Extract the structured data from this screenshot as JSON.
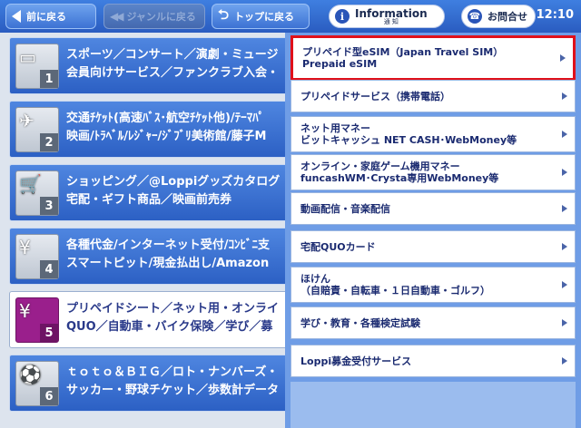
{
  "topbar": {
    "back_label": "前に戻る",
    "genre_back_label": "ジャンルに戻る",
    "top_label": "トップに戻る",
    "info_label": "Information",
    "info_sub": "通 知",
    "contact_label": "お問合せ",
    "time": "12:10"
  },
  "categories": [
    {
      "num": "1",
      "line1": "スポーツ／コンサート／演劇・ミュージ",
      "line2": "会員向けサービス／ファンクラブ入会・",
      "icon": "ticket-icon"
    },
    {
      "num": "2",
      "line1": "交通ﾁｹｯﾄ(高速ﾊﾞｽ･航空ﾁｹｯﾄ他)/ﾃｰﾏﾊﾟ",
      "line2": "映画/ﾄﾗﾍﾞﾙ/ﾚｼﾞｬｰ/ｼﾞﾌﾞﾘ美術館/藤子M",
      "icon": "airplane-icon"
    },
    {
      "num": "3",
      "line1": "ショッピング／@Loppiグッズカタログ",
      "line2": "宅配・ギフト商品／映画前売券",
      "icon": "cart-icon"
    },
    {
      "num": "4",
      "line1": "各種代金/インターネット受付/ｺﾝﾋﾞﾆ支",
      "line2": "スマートピット/現金払出し/Amazon",
      "icon": "yen-icon"
    },
    {
      "num": "5",
      "line1": "プリペイドシート／ネット用・オンライ",
      "line2": "QUO／自動車・バイク保険／学び／募",
      "icon": "prepaid-card-icon"
    },
    {
      "num": "6",
      "line1": "ｔｏｔｏ＆ＢＩＧ／ロト・ナンバーズ・",
      "line2": "サッカー・野球チケット／歩数計データ",
      "icon": "soccer-ball-icon"
    }
  ],
  "submenu": [
    {
      "line1": "プリペイド型eSIM（Japan Travel SIM）",
      "line2": "Prepaid eSIM",
      "highlight": true
    },
    {
      "line1": "プリペイドサービス（携帯電話）",
      "line2": ""
    },
    {
      "line1": "ネット用マネー",
      "line2": "ビットキャッシュ NET CASH･WebMoney等"
    },
    {
      "line1": "オンライン・家庭ゲーム機用マネー",
      "line2": "funcashWM･Crysta専用WebMoney等"
    },
    {
      "line1": "動画配信・音楽配信",
      "line2": ""
    },
    {
      "line1": "宅配QUOカード",
      "line2": ""
    },
    {
      "line1": "ほけん",
      "line2": "（自賠責・自転車・１日自動車・ゴルフ）"
    },
    {
      "line1": "学び・教育・各種検定試験",
      "line2": ""
    },
    {
      "line1": "Loppi募金受付サービス",
      "line2": ""
    }
  ],
  "colors": {
    "highlight": "#e0101a",
    "accent": "#2c60c4",
    "active_icon": "#9a1f8c"
  }
}
